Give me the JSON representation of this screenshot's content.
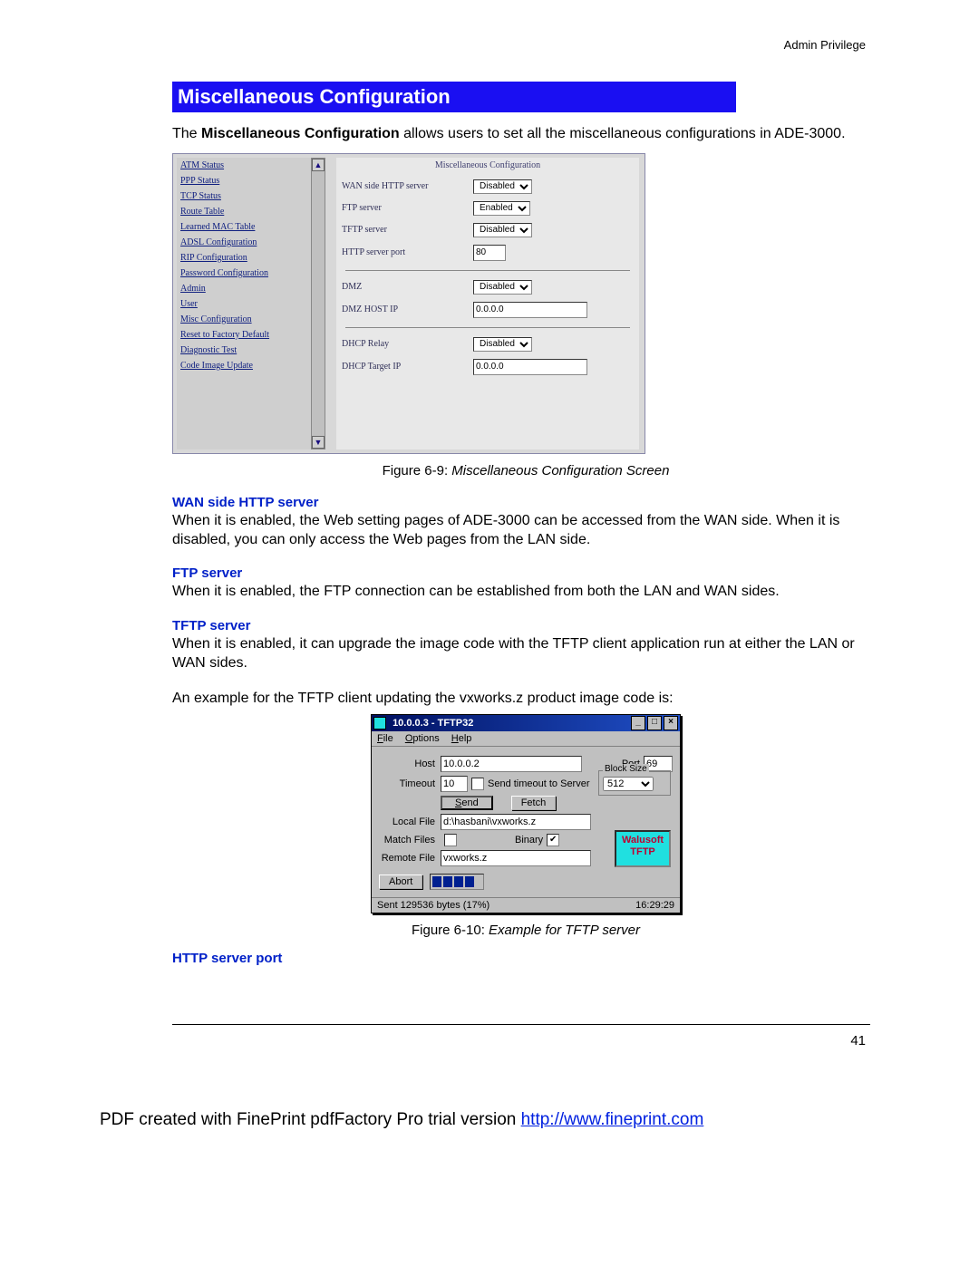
{
  "header_right": "Admin Privilege",
  "page_number": "41",
  "heading": "Miscellaneous Configuration",
  "intro_bold": "Miscellaneous Configuration",
  "intro_rest": " allows users to set all the miscellaneous configurations in ADE-3000.",
  "intro_prefix": "The ",
  "fig69": {
    "caption_prefix": "Figure 6-9: ",
    "caption_italic": "Miscellaneous Configuration Screen",
    "panel_title": "Miscellaneous Configuration",
    "nav": [
      "ATM Status",
      "PPP Status",
      "TCP Status",
      "Route Table",
      "Learned MAC Table",
      "ADSL Configuration",
      "RIP Configuration",
      "Password Configuration",
      "Admin",
      "User",
      "Misc Configuration",
      "Reset to Factory Default",
      "Diagnostic Test",
      "Code Image Update"
    ],
    "rows": {
      "wan_http": {
        "label": "WAN side HTTP server",
        "value": "Disabled"
      },
      "ftp": {
        "label": "FTP server",
        "value": "Enabled"
      },
      "tftp": {
        "label": "TFTP server",
        "value": "Disabled"
      },
      "http_port": {
        "label": "HTTP server port",
        "value": "80"
      },
      "dmz": {
        "label": "DMZ",
        "value": "Disabled"
      },
      "dmz_host": {
        "label": "DMZ HOST IP",
        "value": "0.0.0.0"
      },
      "dhcp_rel": {
        "label": "DHCP Relay",
        "value": "Disabled"
      },
      "dhcp_tgt": {
        "label": "DHCP Target IP",
        "value": "0.0.0.0"
      }
    }
  },
  "sections": {
    "wan_http": {
      "title": "WAN side HTTP server",
      "body": "When it is enabled, the Web setting pages of ADE-3000 can be accessed from the WAN side. When it is disabled, you can only access the Web pages from the LAN side."
    },
    "ftp": {
      "title": "FTP server",
      "body": "When it is enabled, the FTP connection can be established from both the LAN and WAN sides."
    },
    "tftp": {
      "title": "TFTP server",
      "body": "When it is enabled, it can upgrade the image code with the TFTP client application run at either the LAN or WAN sides."
    },
    "example_line": "An example for the TFTP client updating the vxworks.z product image code is:",
    "http_port_title": "HTTP server port"
  },
  "fig610": {
    "caption_prefix": "Figure 6-10: ",
    "caption_italic": "Example for TFTP server",
    "title": "10.0.0.3 - TFTP32",
    "menu": {
      "file": "File",
      "options": "Options",
      "help": "Help"
    },
    "host_label": "Host",
    "host_value": "10.0.0.2",
    "port_label": "Port",
    "port_value": "69",
    "timeout_label": "Timeout",
    "timeout_value": "10",
    "send_timeout_label": "Send timeout to Server",
    "blocksize_label": "Block Size",
    "blocksize_value": "512",
    "send_btn": "Send",
    "fetch_btn": "Fetch",
    "localfile_label": "Local File",
    "localfile_value": "d:\\hasbani\\vxworks.z",
    "matchfiles_label": "Match Files",
    "binary_label": "Binary",
    "remotefile_label": "Remote File",
    "remotefile_value": "vxworks.z",
    "abort_btn": "Abort",
    "logo_line1": "Walusoft",
    "logo_line2": "TFTP",
    "status_left": "Sent 129536 bytes (17%)",
    "status_right": "16:29:29"
  },
  "pdf_line_prefix": "PDF created with FinePrint pdfFactory Pro trial version ",
  "pdf_url": "http://www.fineprint.com"
}
